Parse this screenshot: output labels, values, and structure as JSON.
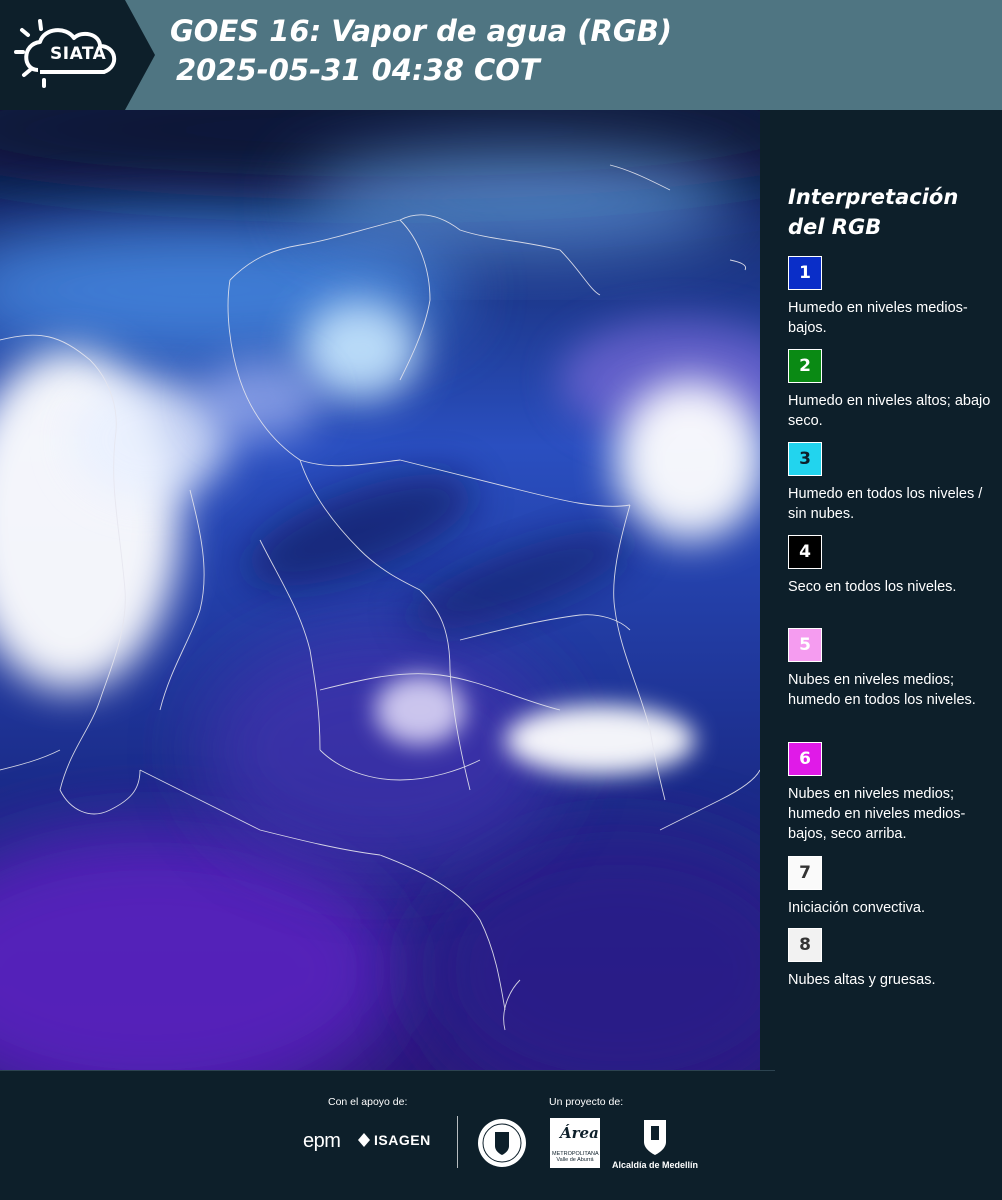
{
  "header": {
    "brand": "SIATA",
    "title_line1": "GOES 16: Vapor de agua (RGB)",
    "title_line2": "2025-05-31 04:38 COT"
  },
  "legend": {
    "title": "Interpretación del RGB",
    "items": [
      {
        "number": "1",
        "color": "#0a2ec8",
        "text_color": "#ffffff",
        "text": "Humedo en niveles medios-bajos."
      },
      {
        "number": "2",
        "color": "#0a8a14",
        "text_color": "#ffffff",
        "text": "Humedo en niveles altos; abajo seco."
      },
      {
        "number": "3",
        "color": "#22d4ee",
        "text_color": "#0d1f2a",
        "text": "Humedo en todos los niveles / sin nubes."
      },
      {
        "number": "4",
        "color": "#000000",
        "text_color": "#ffffff",
        "text": "Seco en todos los niveles."
      },
      {
        "number": "5",
        "color": "#f59cf0",
        "text_color": "#ffffff",
        "text": "Nubes en niveles medios; humedo en todos los niveles."
      },
      {
        "number": "6",
        "color": "#e01ae8",
        "text_color": "#ffffff",
        "text": "Nubes en niveles medios; humedo en niveles medios-bajos, seco arriba."
      },
      {
        "number": "7",
        "color": "#fafafa",
        "text_color": "#333333",
        "text": "Iniciación convectiva."
      },
      {
        "number": "8",
        "color": "#f2f2f2",
        "text_color": "#333333",
        "text": "Nubes altas y gruesas."
      }
    ]
  },
  "footer": {
    "support_label": "Con el apoyo de:",
    "project_label": "Un proyecto de:",
    "epm": "epm",
    "isagen": "ISAGEN",
    "area_logo": "Área",
    "area_sub": "METROPOLITANA Valle de Aburrá",
    "alcaldia": "Alcaldía de Medellín"
  }
}
